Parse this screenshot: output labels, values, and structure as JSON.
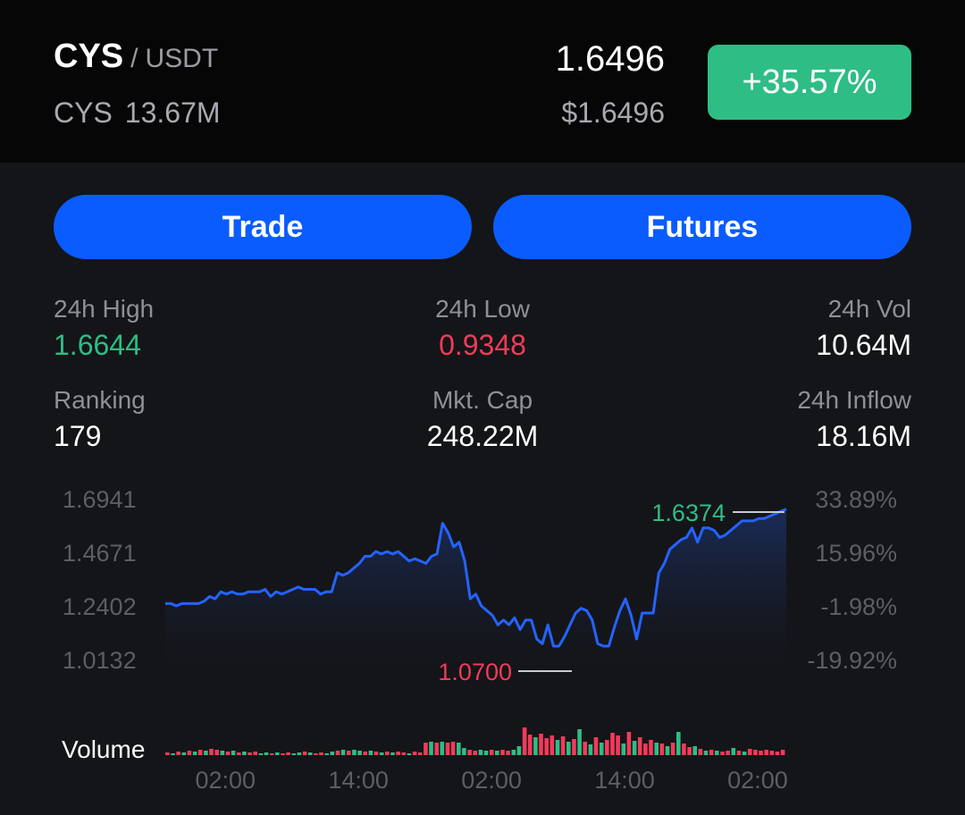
{
  "header": {
    "base": "CYS",
    "separator": "/",
    "quote": "USDT",
    "supply_symbol": "CYS",
    "supply_value": "13.67M",
    "price": "1.6496",
    "price_usd": "$1.6496",
    "change": "+35.57%"
  },
  "actions": {
    "trade": "Trade",
    "futures": "Futures"
  },
  "stats": {
    "high_label": "24h High",
    "high_value": "1.6644",
    "low_label": "24h Low",
    "low_value": "0.9348",
    "vol_label": "24h Vol",
    "vol_value": "10.64M",
    "rank_label": "Ranking",
    "rank_value": "179",
    "cap_label": "Mkt. Cap",
    "cap_value": "248.22M",
    "inflow_label": "24h Inflow",
    "inflow_value": "18.16M"
  },
  "colors": {
    "up": "#2ebd85",
    "down": "#f23a5a",
    "line": "#2563ff",
    "accent": "#0a5cff"
  },
  "chart_data": {
    "type": "area",
    "y_ticks": [
      "1.6941",
      "1.4671",
      "1.2402",
      "1.0132"
    ],
    "y_tick_values": [
      1.6941,
      1.4671,
      1.2402,
      1.0132
    ],
    "pct_ticks": [
      "33.89%",
      "15.96%",
      "-1.98%",
      "-19.92%"
    ],
    "x_ticks": [
      "02:00",
      "14:00",
      "02:00",
      "14:00",
      "02:00"
    ],
    "x_tick_index": [
      6,
      30,
      54,
      78,
      102
    ],
    "high_label": "1.6374",
    "high_value": 1.6374,
    "low_label": "1.0700",
    "low_value": 1.07,
    "volume_label": "Volume",
    "ylim": [
      1.0132,
      1.6941
    ],
    "prices": [
      1.25,
      1.25,
      1.24,
      1.25,
      1.25,
      1.25,
      1.25,
      1.26,
      1.28,
      1.27,
      1.3,
      1.29,
      1.3,
      1.29,
      1.29,
      1.3,
      1.3,
      1.3,
      1.31,
      1.28,
      1.3,
      1.29,
      1.3,
      1.31,
      1.32,
      1.31,
      1.31,
      1.31,
      1.29,
      1.3,
      1.3,
      1.38,
      1.37,
      1.38,
      1.4,
      1.42,
      1.45,
      1.45,
      1.47,
      1.46,
      1.47,
      1.46,
      1.47,
      1.45,
      1.43,
      1.44,
      1.43,
      1.42,
      1.45,
      1.46,
      1.59,
      1.55,
      1.49,
      1.51,
      1.43,
      1.27,
      1.29,
      1.24,
      1.22,
      1.2,
      1.16,
      1.18,
      1.16,
      1.19,
      1.14,
      1.18,
      1.18,
      1.1,
      1.08,
      1.16,
      1.07,
      1.07,
      1.11,
      1.16,
      1.21,
      1.23,
      1.22,
      1.18,
      1.08,
      1.07,
      1.07,
      1.15,
      1.22,
      1.27,
      1.2,
      1.1,
      1.21,
      1.21,
      1.21,
      1.38,
      1.42,
      1.48,
      1.5,
      1.52,
      1.53,
      1.57,
      1.51,
      1.57,
      1.57,
      1.56,
      1.53,
      1.54,
      1.56,
      1.58,
      1.6,
      1.6,
      1.6,
      1.61,
      1.61,
      1.62,
      1.63,
      1.64,
      1.65
    ],
    "volumes": [
      {
        "v": 3,
        "up": false
      },
      {
        "v": 2,
        "up": true
      },
      {
        "v": 4,
        "up": false
      },
      {
        "v": 3,
        "up": true
      },
      {
        "v": 5,
        "up": false
      },
      {
        "v": 4,
        "up": true
      },
      {
        "v": 6,
        "up": false
      },
      {
        "v": 5,
        "up": true
      },
      {
        "v": 7,
        "up": false
      },
      {
        "v": 6,
        "up": false
      },
      {
        "v": 5,
        "up": true
      },
      {
        "v": 4,
        "up": false
      },
      {
        "v": 5,
        "up": true
      },
      {
        "v": 3,
        "up": false
      },
      {
        "v": 4,
        "up": true
      },
      {
        "v": 3,
        "up": false
      },
      {
        "v": 4,
        "up": false
      },
      {
        "v": 2,
        "up": true
      },
      {
        "v": 3,
        "up": true
      },
      {
        "v": 2,
        "up": false
      },
      {
        "v": 3,
        "up": true
      },
      {
        "v": 2,
        "up": false
      },
      {
        "v": 3,
        "up": false
      },
      {
        "v": 2,
        "up": true
      },
      {
        "v": 3,
        "up": true
      },
      {
        "v": 4,
        "up": false
      },
      {
        "v": 3,
        "up": true
      },
      {
        "v": 2,
        "up": false
      },
      {
        "v": 3,
        "up": false
      },
      {
        "v": 2,
        "up": true
      },
      {
        "v": 4,
        "up": true
      },
      {
        "v": 5,
        "up": false
      },
      {
        "v": 6,
        "up": true
      },
      {
        "v": 5,
        "up": false
      },
      {
        "v": 6,
        "up": true
      },
      {
        "v": 5,
        "up": true
      },
      {
        "v": 4,
        "up": false
      },
      {
        "v": 5,
        "up": true
      },
      {
        "v": 4,
        "up": false
      },
      {
        "v": 3,
        "up": true
      },
      {
        "v": 4,
        "up": false
      },
      {
        "v": 3,
        "up": true
      },
      {
        "v": 4,
        "up": false
      },
      {
        "v": 3,
        "up": false
      },
      {
        "v": 2,
        "up": true
      },
      {
        "v": 4,
        "up": false
      },
      {
        "v": 3,
        "up": false
      },
      {
        "v": 14,
        "up": false
      },
      {
        "v": 15,
        "up": true
      },
      {
        "v": 14,
        "up": false
      },
      {
        "v": 15,
        "up": true
      },
      {
        "v": 14,
        "up": false
      },
      {
        "v": 15,
        "up": false
      },
      {
        "v": 14,
        "up": true
      },
      {
        "v": 8,
        "up": true
      },
      {
        "v": 6,
        "up": false
      },
      {
        "v": 5,
        "up": false
      },
      {
        "v": 6,
        "up": true
      },
      {
        "v": 5,
        "up": true
      },
      {
        "v": 6,
        "up": false
      },
      {
        "v": 5,
        "up": true
      },
      {
        "v": 6,
        "up": false
      },
      {
        "v": 5,
        "up": false
      },
      {
        "v": 6,
        "up": true
      },
      {
        "v": 10,
        "up": true
      },
      {
        "v": 31,
        "up": false
      },
      {
        "v": 23,
        "up": false
      },
      {
        "v": 20,
        "up": true
      },
      {
        "v": 24,
        "up": false
      },
      {
        "v": 19,
        "up": false
      },
      {
        "v": 22,
        "up": false
      },
      {
        "v": 17,
        "up": true
      },
      {
        "v": 21,
        "up": false
      },
      {
        "v": 15,
        "up": true
      },
      {
        "v": 18,
        "up": false
      },
      {
        "v": 29,
        "up": true
      },
      {
        "v": 15,
        "up": false
      },
      {
        "v": 12,
        "up": true
      },
      {
        "v": 20,
        "up": false
      },
      {
        "v": 14,
        "up": true
      },
      {
        "v": 17,
        "up": false
      },
      {
        "v": 25,
        "up": false
      },
      {
        "v": 22,
        "up": false
      },
      {
        "v": 13,
        "up": true
      },
      {
        "v": 26,
        "up": false
      },
      {
        "v": 16,
        "up": true
      },
      {
        "v": 20,
        "up": false
      },
      {
        "v": 13,
        "up": false
      },
      {
        "v": 17,
        "up": false
      },
      {
        "v": 14,
        "up": true
      },
      {
        "v": 13,
        "up": false
      },
      {
        "v": 10,
        "up": true
      },
      {
        "v": 14,
        "up": false
      },
      {
        "v": 26,
        "up": true
      },
      {
        "v": 13,
        "up": false
      },
      {
        "v": 9,
        "up": false
      },
      {
        "v": 10,
        "up": true
      },
      {
        "v": 7,
        "up": false
      },
      {
        "v": 5,
        "up": true
      },
      {
        "v": 6,
        "up": false
      },
      {
        "v": 5,
        "up": true
      },
      {
        "v": 4,
        "up": false
      },
      {
        "v": 5,
        "up": false
      },
      {
        "v": 8,
        "up": true
      },
      {
        "v": 5,
        "up": false
      },
      {
        "v": 4,
        "up": true
      },
      {
        "v": 7,
        "up": false
      },
      {
        "v": 6,
        "up": false
      },
      {
        "v": 5,
        "up": false
      },
      {
        "v": 6,
        "up": false
      },
      {
        "v": 5,
        "up": false
      },
      {
        "v": 4,
        "up": false
      },
      {
        "v": 6,
        "up": false
      }
    ]
  }
}
